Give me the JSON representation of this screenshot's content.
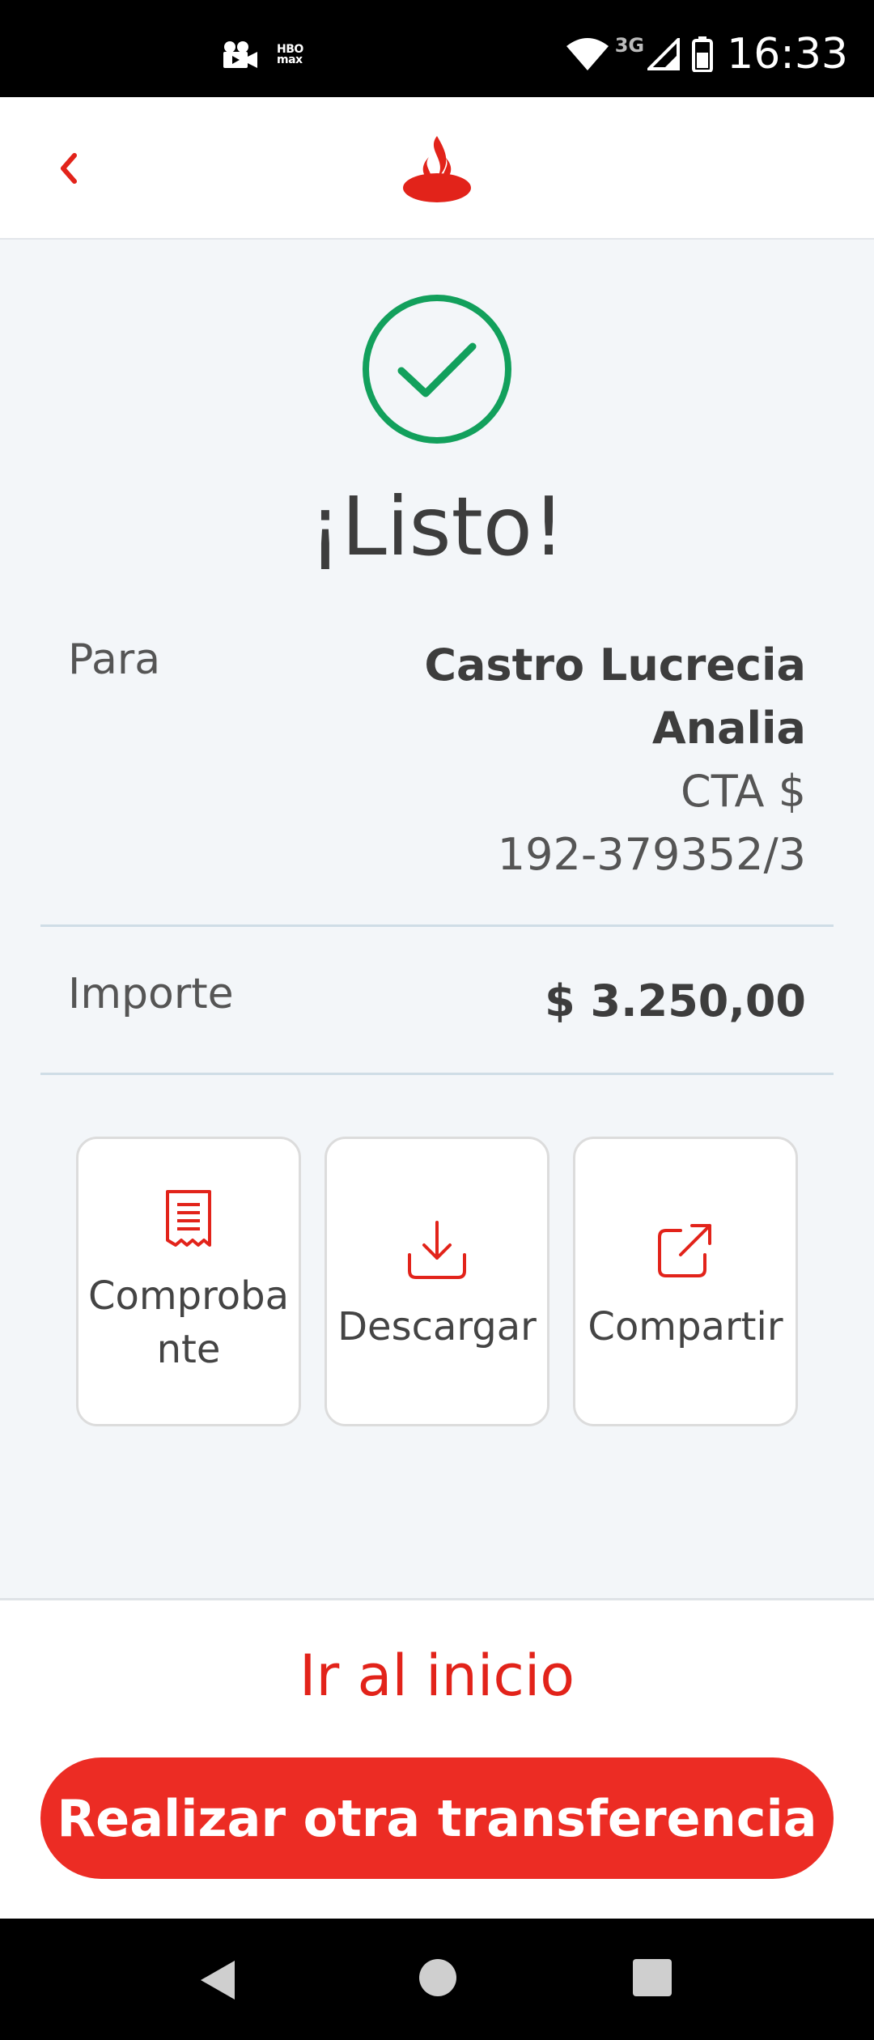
{
  "status_bar": {
    "time": "16:33",
    "network": "3G",
    "hbo_label": "HBO max"
  },
  "header": {
    "back_icon": "chevron-left-icon",
    "logo_icon": "santander-flame-logo"
  },
  "confirmation": {
    "icon": "check-circle-icon",
    "title": "¡Listo!"
  },
  "recipient": {
    "label": "Para",
    "name_line1": "Castro Lucrecia",
    "name_line2": "Analia",
    "account_type": "CTA $",
    "account_number": "192-379352/3"
  },
  "amount": {
    "label": "Importe",
    "value": "$ 3.250,00"
  },
  "actions": [
    {
      "label_line1": "Comproba",
      "label_line2": "nte",
      "icon": "receipt-icon"
    },
    {
      "label": "Descargar",
      "icon": "download-icon"
    },
    {
      "label": "Compartir",
      "icon": "share-icon"
    }
  ],
  "footer": {
    "home_link": "Ir al inicio",
    "primary_button": "Realizar otra transferencia"
  },
  "colors": {
    "brand_red": "#ec2c24",
    "success_green": "#12a05c",
    "background": "#f3f6f9"
  }
}
